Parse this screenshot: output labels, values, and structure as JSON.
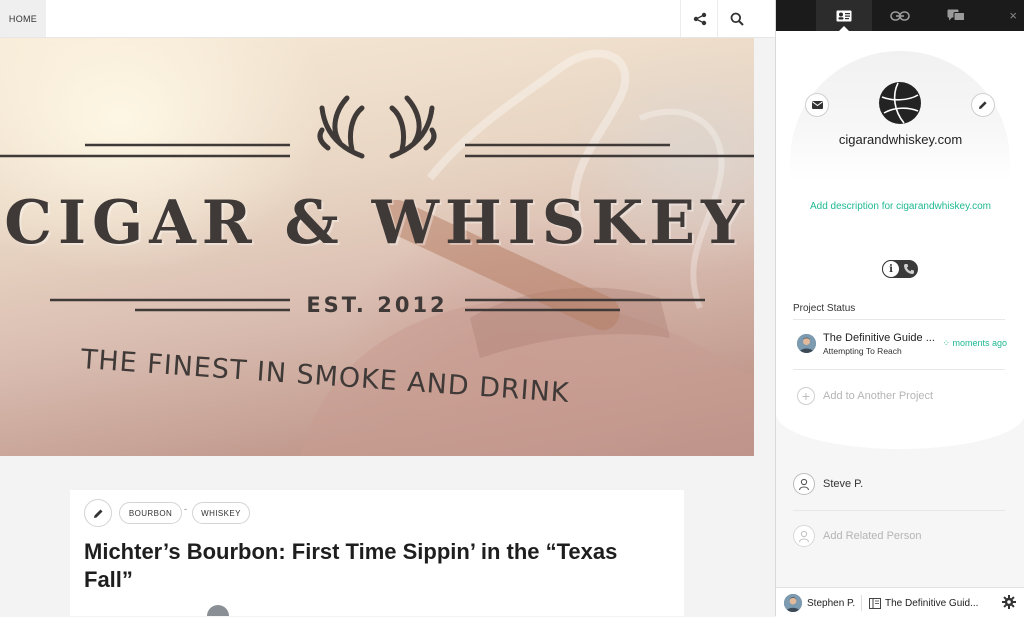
{
  "site": {
    "nav": {
      "home_label": "HOME",
      "icons": [
        "share-icon",
        "search-icon"
      ]
    },
    "hero": {
      "title": "CIGAR & WHISKEY",
      "est": "EST. 2012",
      "tagline": "THE FINEST IN SMOKE AND DRINK"
    },
    "article": {
      "tags": [
        "BOURBON",
        "WHISKEY"
      ],
      "tag_separator": "-",
      "title": "Michter’s Bourbon: First Time Sippin’ in the “Texas Fall”"
    }
  },
  "panel": {
    "tabs": [
      {
        "icon": "contact-card-icon",
        "active": true
      },
      {
        "icon": "link-icon",
        "active": false
      },
      {
        "icon": "chat-icon",
        "active": false
      }
    ],
    "close_label": "×",
    "domain": "cigarandwhiskey.com",
    "add_description": "Add description for cigarandwhiskey.com",
    "project_status_label": "Project Status",
    "project": {
      "name": "The Definitive Guide ...",
      "status": "Attempting To Reach",
      "time": "moments ago"
    },
    "add_project": "Add to Another Project",
    "person": "Steve P.",
    "add_person": "Add Related Person",
    "footer": {
      "user": "Stephen P.",
      "project": "The Definitive Guid..."
    },
    "colors": {
      "accent": "#1fb992",
      "tab_bar": "#1b1b1b"
    }
  }
}
